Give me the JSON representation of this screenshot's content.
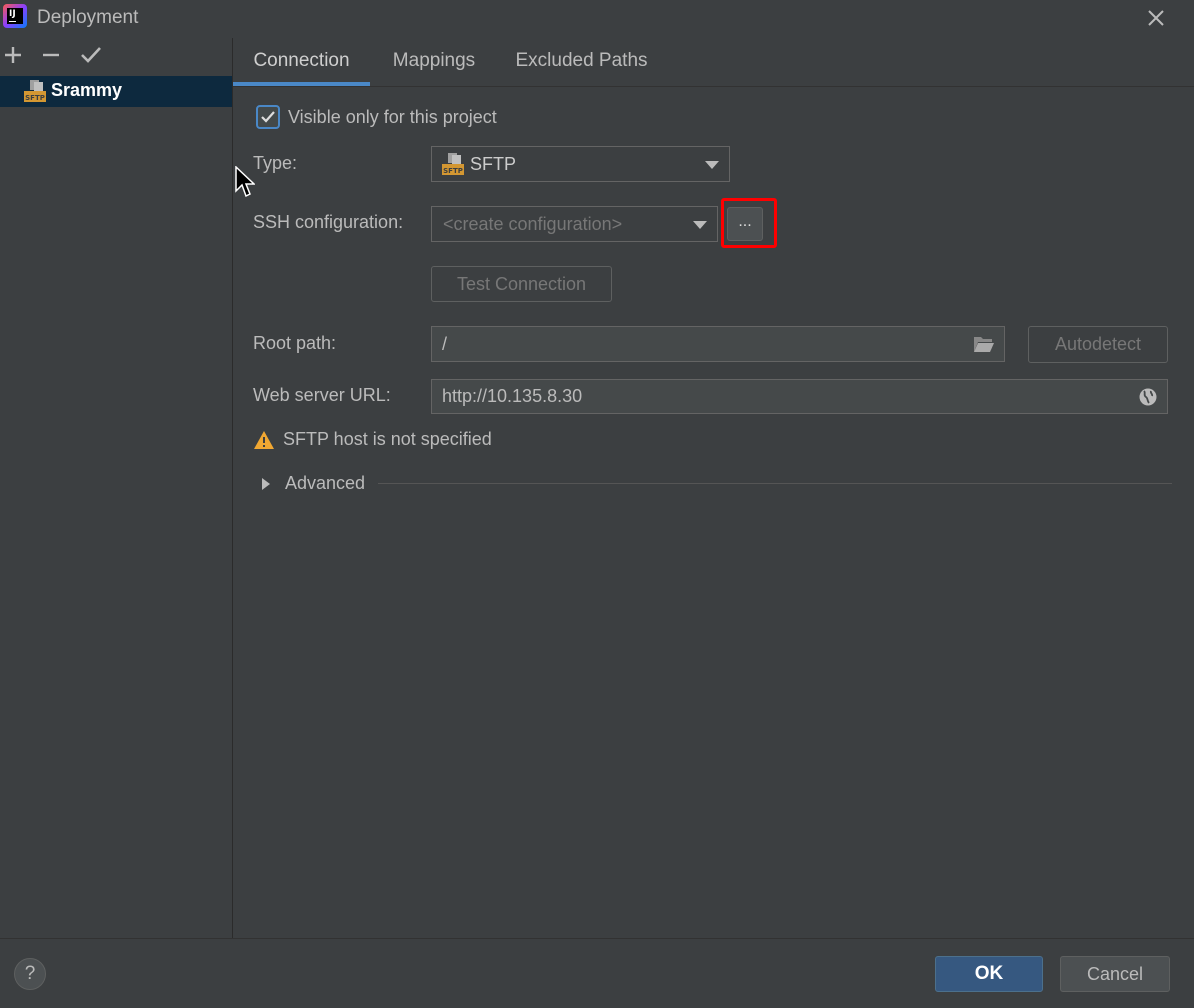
{
  "window": {
    "title": "Deployment"
  },
  "sidebar": {
    "toolbar": {
      "add_icon": "plus-icon",
      "remove_icon": "minus-icon",
      "apply_icon": "check-icon"
    },
    "servers": [
      {
        "name": "Srammy",
        "icon": "sftp-server-icon",
        "selected": true
      }
    ]
  },
  "tabs": [
    {
      "label": "Connection",
      "active": true
    },
    {
      "label": "Mappings",
      "active": false
    },
    {
      "label": "Excluded Paths",
      "active": false
    }
  ],
  "connection": {
    "visible_only_label": "Visible only for this project",
    "visible_only_checked": true,
    "type_label": "Type:",
    "type_value": "SFTP",
    "ssh_label": "SSH configuration:",
    "ssh_placeholder": "<create configuration>",
    "ssh_browse_label": "...",
    "test_connection_label": "Test Connection",
    "root_path_label": "Root path:",
    "root_path_value": "/",
    "autodetect_label": "Autodetect",
    "web_url_label": "Web server URL:",
    "web_url_value": "http://10.135.8.30",
    "warning_text": "SFTP host is not specified",
    "advanced_label": "Advanced"
  },
  "footer": {
    "help_label": "?",
    "ok_label": "OK",
    "cancel_label": "Cancel"
  },
  "colors": {
    "accent": "#4a88c7",
    "warning": "#f0a732",
    "highlight": "#ff0000",
    "ok_button": "#365880"
  }
}
